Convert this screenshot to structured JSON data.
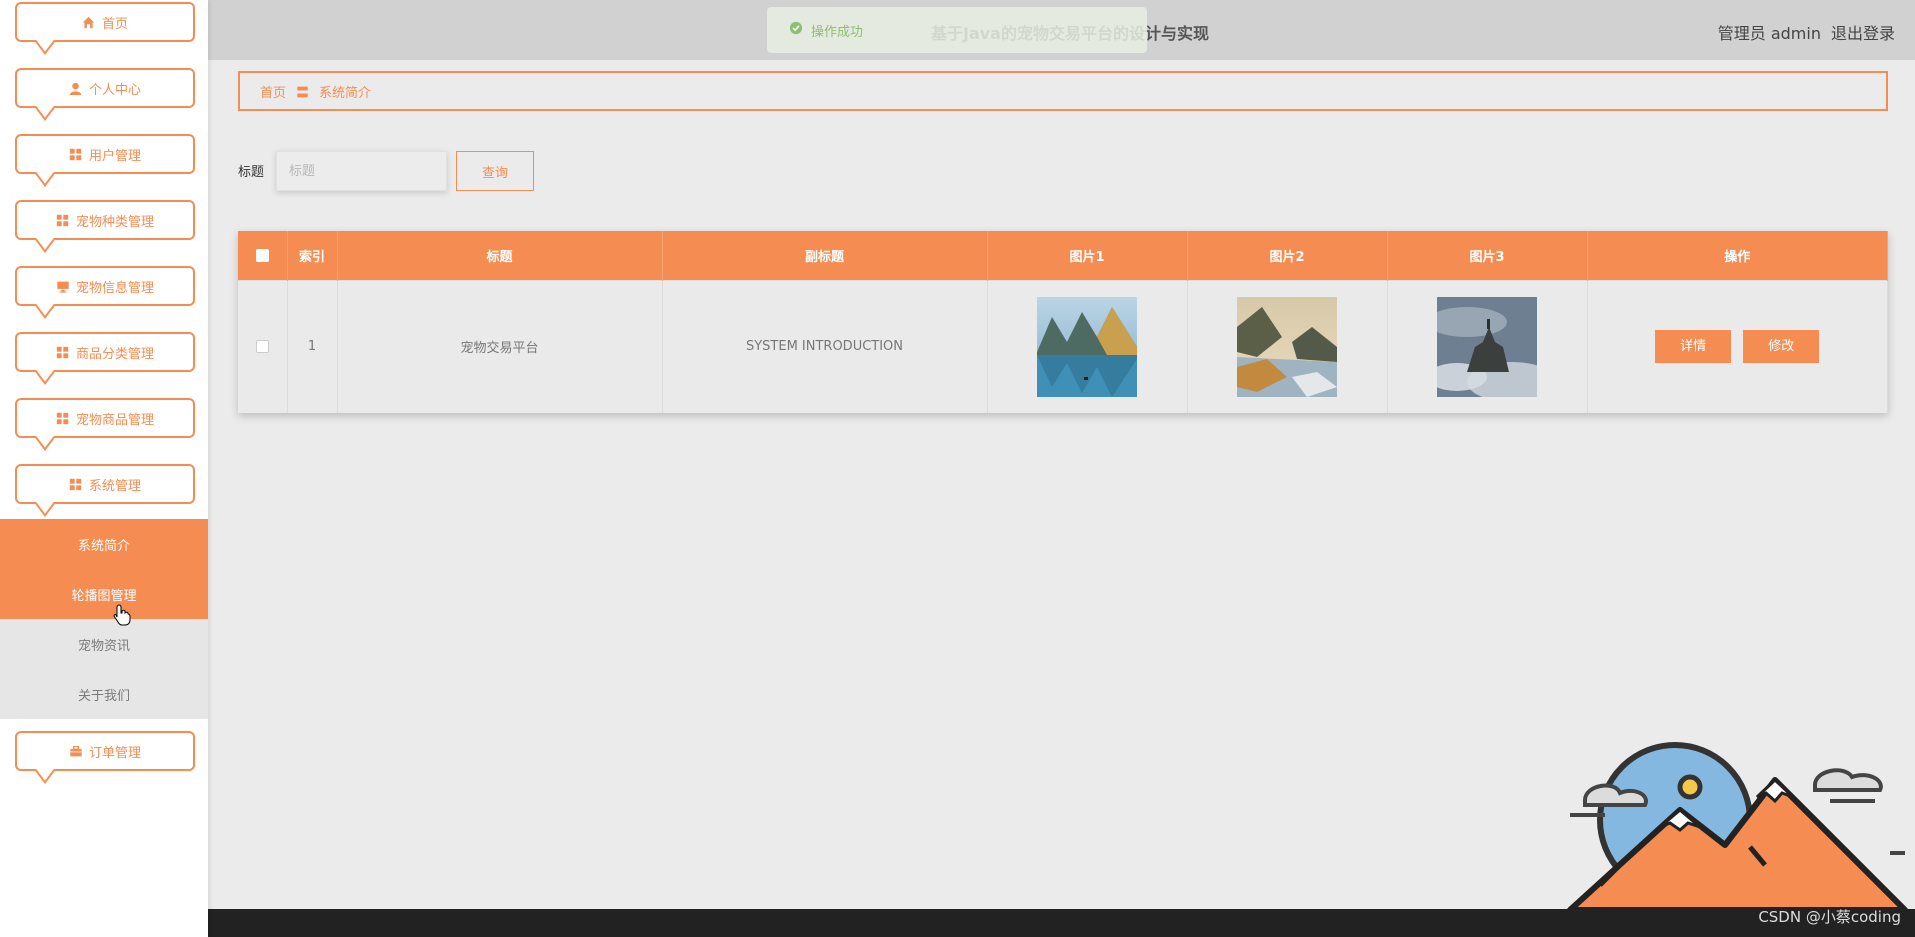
{
  "app": {
    "title": "基于Java的宠物交易平台的设计与实现"
  },
  "header": {
    "user_label": "管理员 admin",
    "logout_label": "退出登录"
  },
  "toast": {
    "message": "操作成功"
  },
  "sidebar": {
    "items": [
      {
        "label": "首页",
        "icon": "home-icon"
      },
      {
        "label": "个人中心",
        "icon": "user-icon"
      },
      {
        "label": "用户管理",
        "icon": "grid-icon"
      },
      {
        "label": "宠物种类管理",
        "icon": "grid-icon"
      },
      {
        "label": "宠物信息管理",
        "icon": "monitor-icon"
      },
      {
        "label": "商品分类管理",
        "icon": "grid-icon"
      },
      {
        "label": "宠物商品管理",
        "icon": "grid-icon"
      },
      {
        "label": "系统管理",
        "icon": "grid-icon"
      }
    ],
    "submenu": [
      "系统简介",
      "轮播图管理",
      "宠物资讯",
      "关于我们"
    ],
    "order_item": {
      "label": "订单管理",
      "icon": "briefcase-icon"
    }
  },
  "breadcrumb": {
    "home": "首页",
    "sep": "〓",
    "current": "系统简介"
  },
  "search": {
    "label": "标题",
    "placeholder": "标题",
    "button": "查询"
  },
  "table": {
    "columns": [
      "索引",
      "标题",
      "副标题",
      "图片1",
      "图片2",
      "图片3",
      "操作"
    ],
    "rows": [
      {
        "index": "1",
        "title": "宠物交易平台",
        "subtitle": "SYSTEM INTRODUCTION",
        "detail": "详情",
        "edit": "修改"
      }
    ]
  },
  "footer": {
    "watermark": "CSDN @小蔡coding"
  },
  "colors": {
    "accent": "#f58d53",
    "topbar": "#d2d1d2",
    "background": "#ebebeb"
  }
}
